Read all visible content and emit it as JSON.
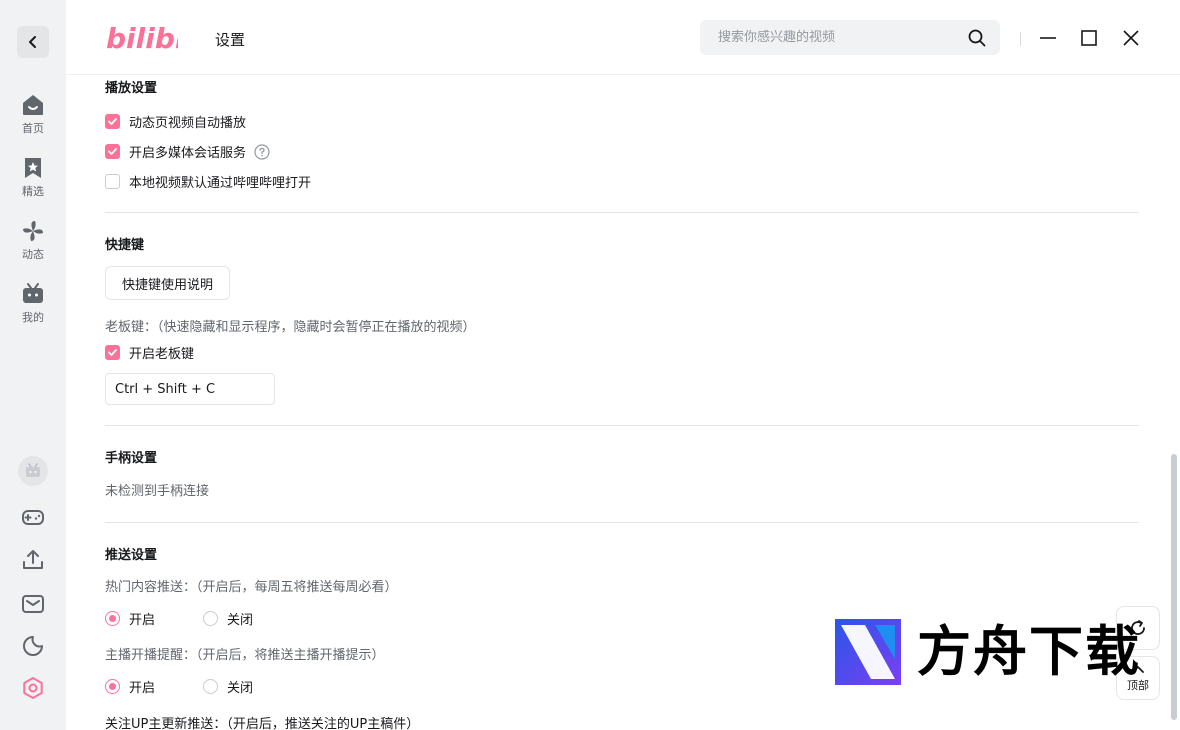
{
  "header": {
    "logo": "bilibili",
    "title": "设置",
    "search_placeholder": "搜索你感兴趣的视频"
  },
  "sidebar": {
    "items": [
      {
        "label": "首页",
        "icon": "home-icon"
      },
      {
        "label": "精选",
        "icon": "bookmark-icon"
      },
      {
        "label": "动态",
        "icon": "pinwheel-icon"
      },
      {
        "label": "我的",
        "icon": "tv-icon"
      }
    ],
    "bottom_icons": [
      "avatar",
      "gamepad-icon",
      "upload-icon",
      "mail-icon",
      "moon-icon",
      "settings-icon"
    ]
  },
  "sections": {
    "playback": {
      "title": "播放设置",
      "options": [
        {
          "label": "动态页视频自动播放",
          "checked": true
        },
        {
          "label": "开启多媒体会话服务",
          "checked": true
        },
        {
          "label": "本地视频默认通过哔哩哔哩打开",
          "checked": false
        }
      ]
    },
    "shortcuts": {
      "title": "快捷键",
      "help_button": "快捷键使用说明",
      "boss_key_desc": "老板键：（快速隐藏和显示程序，隐藏时会暂停正在播放的视频）",
      "boss_key_toggle": "开启老板键",
      "boss_key_value": "Ctrl + Shift + C"
    },
    "gamepad": {
      "title": "手柄设置",
      "status": "未检测到手柄连接"
    },
    "push": {
      "title": "推送设置",
      "hot_desc": "热门内容推送：（开启后，每周五将推送每周必看）",
      "live_desc": "主播开播提醒：（开启后，将推送主播开播提示）",
      "follow_desc": "关注UP主更新推送：（开启后，推送关注的UP主稿件）",
      "on_label": "开启",
      "off_label": "关闭"
    }
  },
  "float": {
    "top_label": "顶部"
  },
  "watermark": {
    "text": "方舟下载"
  },
  "colors": {
    "accent": "#fb7299",
    "sidebar_bg": "#f1f2f3"
  }
}
